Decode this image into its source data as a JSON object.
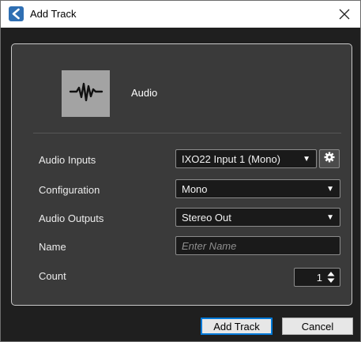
{
  "window": {
    "title": "Add Track"
  },
  "track": {
    "type_label": "Audio",
    "icon": "waveform-icon"
  },
  "rows": {
    "audio_inputs": {
      "label": "Audio Inputs",
      "value": "IXO22 Input 1 (Mono)"
    },
    "configuration": {
      "label": "Configuration",
      "value": "Mono"
    },
    "audio_outputs": {
      "label": "Audio Outputs",
      "value": "Stereo Out"
    },
    "name": {
      "label": "Name",
      "placeholder": "Enter Name",
      "value": ""
    },
    "count": {
      "label": "Count",
      "value": "1"
    }
  },
  "buttons": {
    "add_track": "Add Track",
    "cancel": "Cancel"
  },
  "colors": {
    "panel_bg": "#3a3a3a",
    "field_bg": "#1a1a1a",
    "tile_bg": "#a3a3a3",
    "primary_border": "#0078d7"
  }
}
